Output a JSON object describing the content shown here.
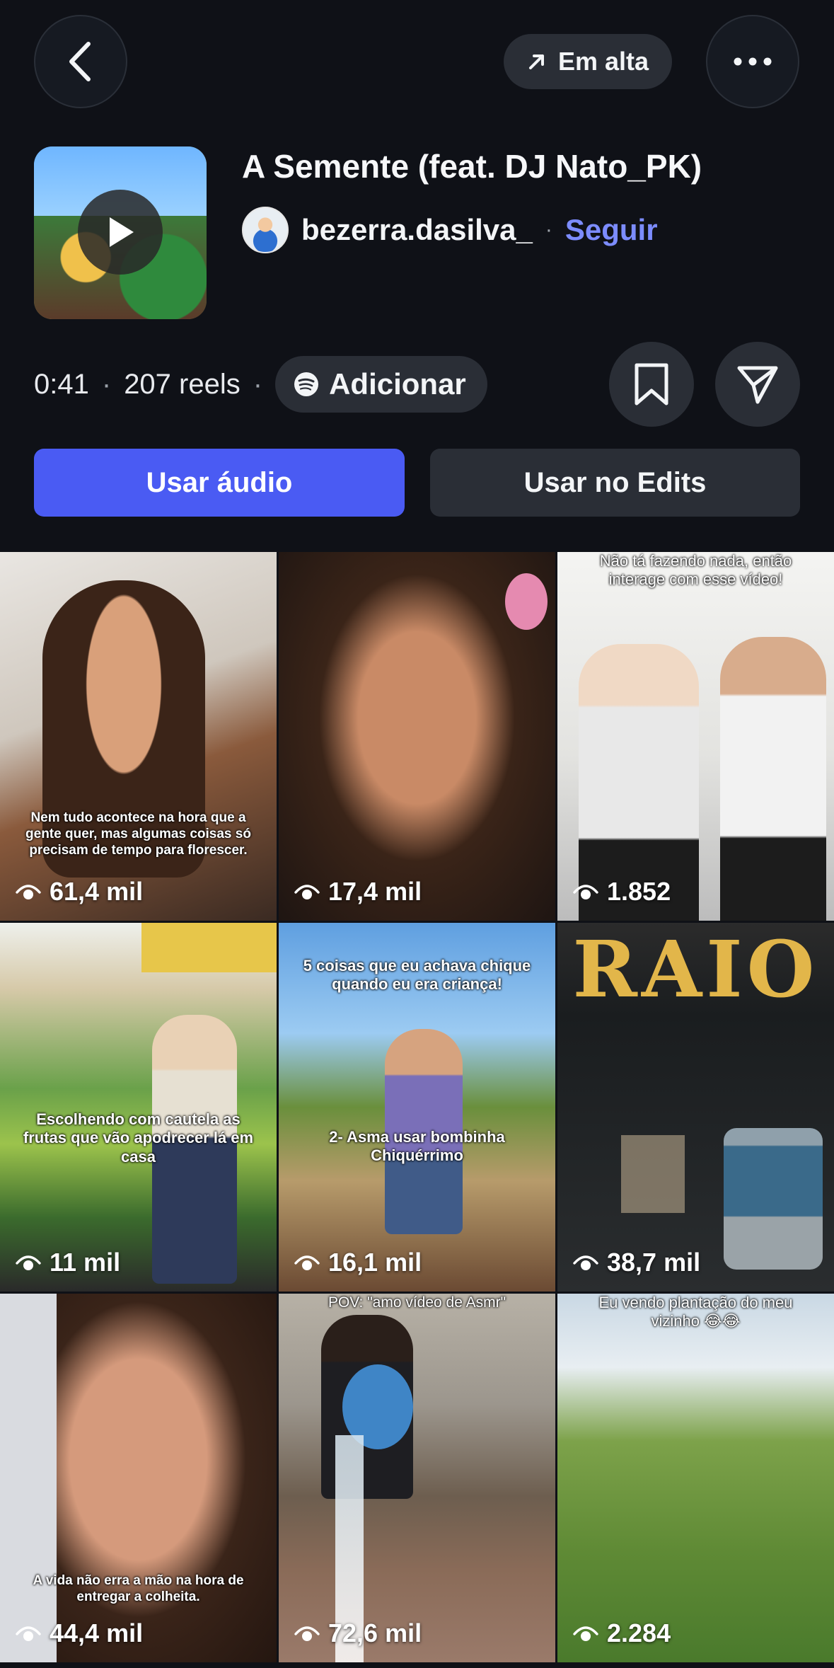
{
  "topbar": {
    "trending_label": "Em alta"
  },
  "track": {
    "title": "A Semente (feat. DJ Nato_PK)",
    "author": "bezerra.dasilva_",
    "separator": "·",
    "follow_label": "Seguir",
    "duration": "0:41",
    "reels_count": "207 reels",
    "add_label": "Adicionar"
  },
  "actions": {
    "use_audio": "Usar áudio",
    "use_edits": "Usar no Edits"
  },
  "reels": [
    {
      "views": "61,4 mil",
      "caption": "Nem tudo acontece na hora que a gente quer, mas algumas coisas só precisam de tempo para florescer."
    },
    {
      "views": "17,4 mil",
      "caption": ""
    },
    {
      "views": "1.852",
      "caption": "Não tá fazendo nada, então interage com esse vídeo!"
    },
    {
      "views": "11 mil",
      "caption": "Escolhendo com cautela as frutas que vão apodrecer lá em casa"
    },
    {
      "views": "16,1 mil",
      "caption": "5 coisas que eu achava chique quando eu era criança!",
      "caption2": "2- Asma usar bombinha Chiquérrimo"
    },
    {
      "views": "38,7 mil",
      "caption": "RAIO"
    },
    {
      "views": "44,4 mil",
      "caption": "A vida não erra a mão na hora de entregar a colheita."
    },
    {
      "views": "72,6 mil",
      "caption": "POV: \"amo vídeo de Asmr\""
    },
    {
      "views": "2.284",
      "caption": "Eu vendo plantação do meu vizinho 😂😂"
    }
  ],
  "colors": {
    "background": "#0f1117",
    "primary_button": "#4a5bf3",
    "follow_link": "#7c8cff",
    "secondary_surface": "#2a2e36"
  },
  "icons": [
    "back-icon",
    "trending-arrow-icon",
    "more-icon",
    "play-icon",
    "spotify-icon",
    "bookmark-icon",
    "share-icon",
    "eye-icon"
  ]
}
